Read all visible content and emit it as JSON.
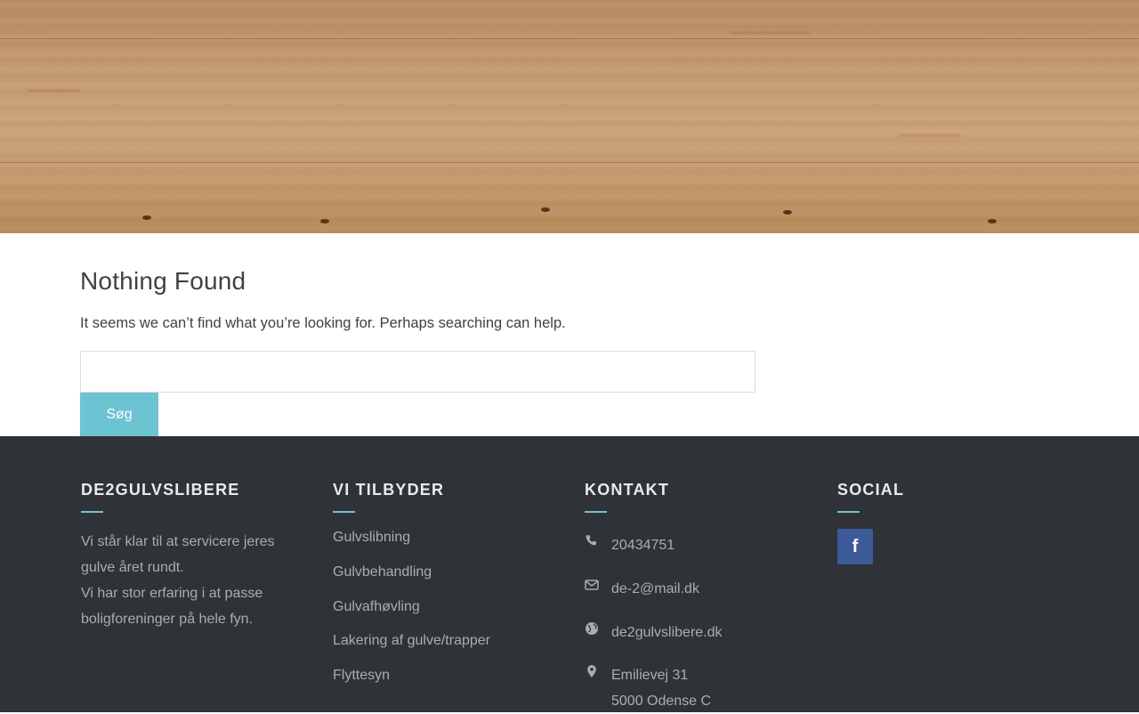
{
  "main": {
    "title": "Nothing Found",
    "notice": "It seems we can’t find what you’re looking for. Perhaps searching can help.",
    "search": {
      "value": "",
      "button_label": "Søg"
    }
  },
  "footer": {
    "about": {
      "heading": "DE2GULVSLIBERE",
      "lines": [
        "Vi står klar til at servicere jeres gulve året rundt.",
        "Vi har stor erfaring i at passe boligforeninger på hele fyn."
      ]
    },
    "services": {
      "heading": "VI TILBYDER",
      "items": [
        "Gulvslibning",
        "Gulvbehandling",
        "Gulvafhøvling",
        "Lakering af gulve/trapper",
        "Flyttesyn"
      ]
    },
    "contact": {
      "heading": "KONTAKT",
      "phone": "20434751",
      "email": "de-2@mail.dk",
      "website": "de2gulvslibere.dk",
      "address": [
        "Emilievej 31",
        "5000 Odense C"
      ]
    },
    "social": {
      "heading": "SOCIAL",
      "facebook_glyph": "f",
      "facebook_color": "#3d5a98"
    },
    "accent_color": "#6cc3d1"
  }
}
